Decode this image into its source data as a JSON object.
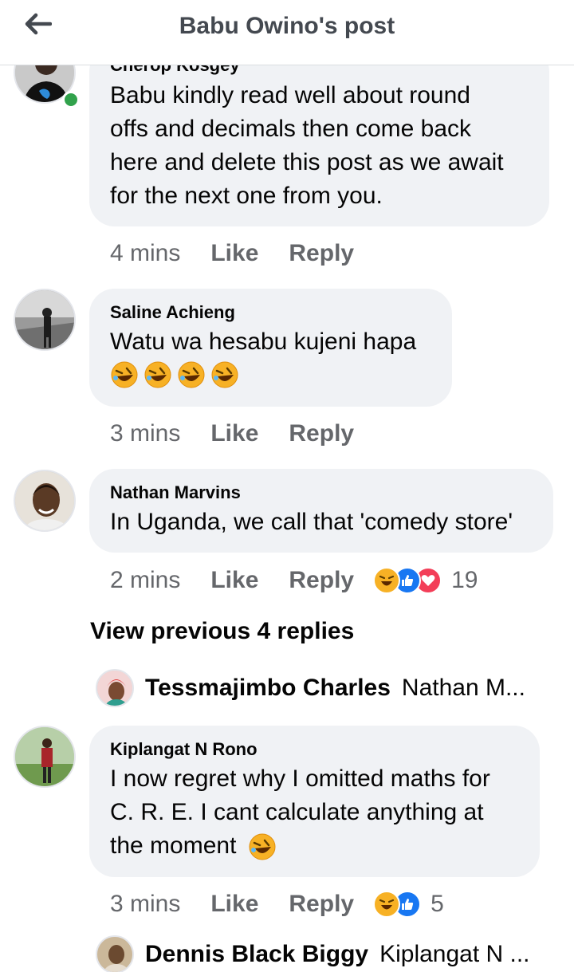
{
  "header": {
    "title": "Babu Owino's post",
    "back_icon": "arrow-left-icon"
  },
  "comments": [
    {
      "author": "Cherop Kosgey",
      "lines": [
        "Babu kindly read well about round",
        "offs and decimals then come back",
        "here and delete this post as we await",
        "for  the next one from you."
      ],
      "time": "4 mins",
      "like": "Like",
      "reply": "Reply",
      "online": true
    },
    {
      "author": "Saline Achieng",
      "lines": [
        "Watu wa hesabu kujeni hapa"
      ],
      "emoji_line": "🤣🤣🤣🤣",
      "time": "3 mins",
      "like": "Like",
      "reply": "Reply"
    },
    {
      "author": "Nathan Marvins",
      "lines": [
        "In Uganda, we call that 'comedy store'"
      ],
      "time": "2 mins",
      "like": "Like",
      "reply": "Reply",
      "reactions": [
        "haha",
        "like",
        "love"
      ],
      "reaction_count": "19"
    },
    {
      "author": "Kiplangat N Rono",
      "lines": [
        "I now regret why I omitted maths for",
        "C. R. E. I cant calculate anything at",
        "the moment"
      ],
      "time": "3 mins",
      "like": "Like",
      "reply": "Reply",
      "reactions": [
        "haha",
        "like"
      ],
      "reaction_count": "5"
    }
  ],
  "view_previous": "View previous 4 replies",
  "replies": [
    {
      "name": "Tessmajimbo Charles",
      "snippet": "Nathan M..."
    },
    {
      "name": "Dennis Black Biggy",
      "snippet": "Kiplangat N ..."
    }
  ],
  "colors": {
    "bubble": "#f0f2f5",
    "meta": "#65676b",
    "like_blue": "#1877f2",
    "love_red": "#f33e58",
    "haha_yellow": "#f7b125",
    "online_green": "#31a24c"
  }
}
